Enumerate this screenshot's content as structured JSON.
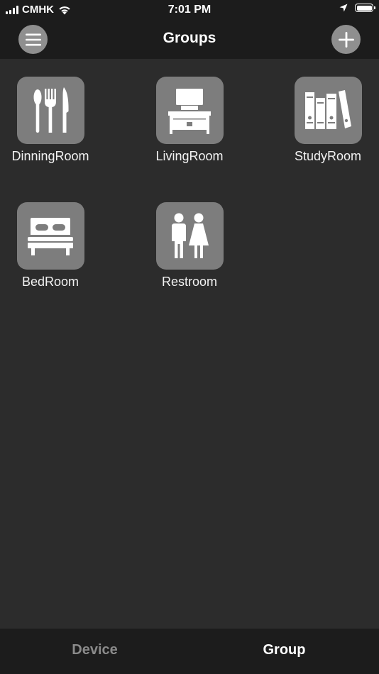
{
  "status_bar": {
    "carrier": "CMHK",
    "time": "7:01 PM",
    "icons": [
      "signal-icon",
      "wifi-icon",
      "location-icon",
      "battery-icon"
    ]
  },
  "nav": {
    "title": "Groups",
    "menu_icon": "hamburger-menu-icon",
    "add_icon": "plus-icon"
  },
  "groups": [
    {
      "label": "DinningRoom",
      "icon": "cutlery-icon"
    },
    {
      "label": "LivingRoom",
      "icon": "tv-stand-icon"
    },
    {
      "label": "StudyRoom",
      "icon": "books-icon"
    },
    {
      "label": "BedRoom",
      "icon": "bed-icon"
    },
    {
      "label": "Restroom",
      "icon": "restroom-icon"
    }
  ],
  "tabs": {
    "device": "Device",
    "group": "Group",
    "active": "Group"
  },
  "colors": {
    "background": "#2c2c2c",
    "bar": "#1c1c1c",
    "tile": "#7d7d7d",
    "inactive_tab": "#8a8a8a",
    "round_button": "#8f8f8f"
  }
}
